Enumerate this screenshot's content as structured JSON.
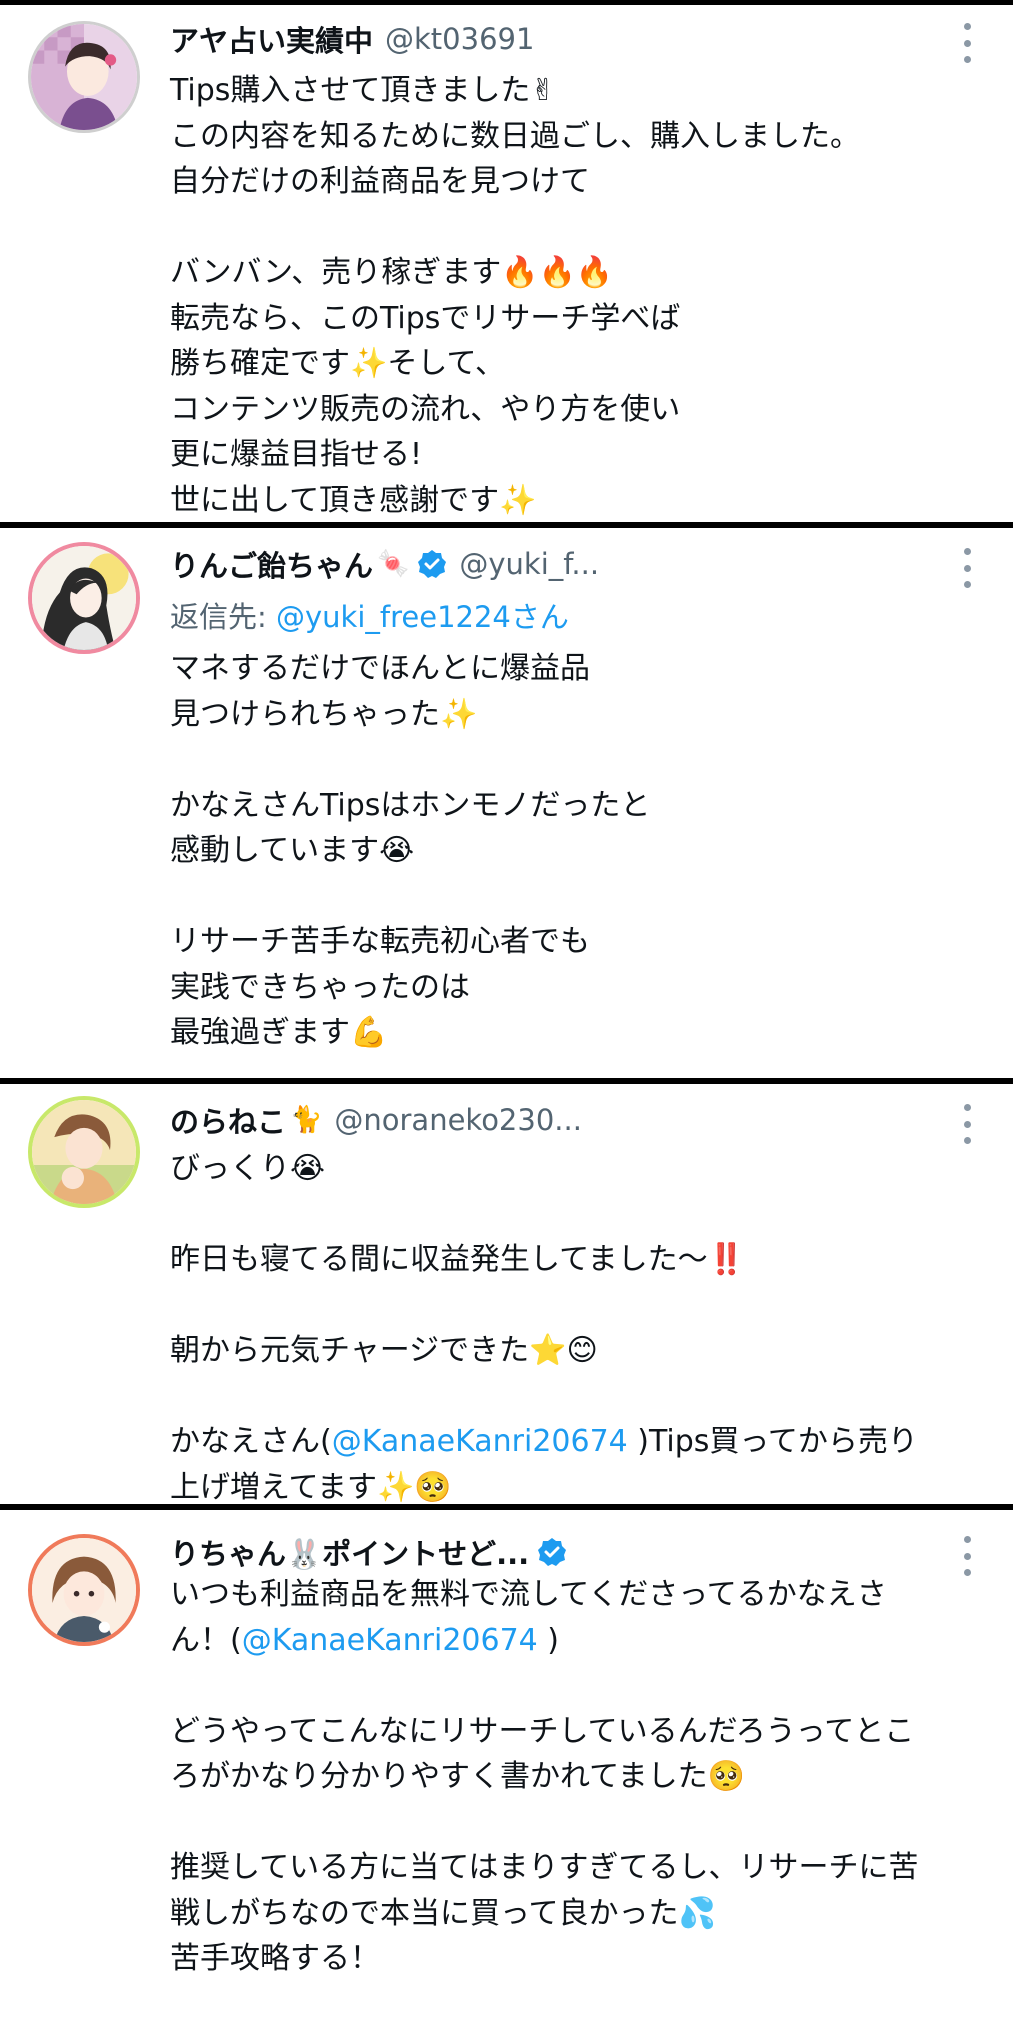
{
  "tweets": [
    {
      "name": "アヤ占い実績中",
      "handle": "@kt03691",
      "body": {
        "l1": "Tips購入させて頂きました✌",
        "l2": "この内容を知るために数日過ごし、購入しました。",
        "l3": "自分だけの利益商品を見つけて",
        "l4": "バンバン、売り稼ぎます🔥🔥🔥",
        "l5": "転売なら、このTipsでリサーチ学べば",
        "l6": "勝ち確定です✨そして、",
        "l7": "コンテンツ販売の流れ、やり方を使い",
        "l8": "更に爆益目指せる!",
        "l9": "世に出して頂き感謝です✨"
      }
    },
    {
      "name": "りんご飴ちゃん",
      "name_emoji": "🍬",
      "handle": "@yuki_f...",
      "reply_prefix": "返信先: ",
      "reply_to": "@yuki_free1224さん",
      "body": {
        "l1": "マネするだけでほんとに爆益品",
        "l2": "見つけられちゃった✨",
        "l3": "かなえさんTipsはホンモノだったと",
        "l4": "感動しています😭",
        "l5": "リサーチ苦手な転売初心者でも",
        "l6": "実践できちゃったのは",
        "l7": "最強過ぎます💪"
      }
    },
    {
      "name": "のらねこ",
      "name_emoji": "🐈",
      "handle": "@noraneko230...",
      "body": {
        "l1": "びっくり😭",
        "l2": "昨日も寝てる間に収益発生してました〜‼️",
        "l3": "朝から元気チャージできた⭐😊",
        "l4a": "かなえさん(",
        "l4m": "@KanaeKanri20674",
        "l4b": " )Tips買ってから売り",
        "l5": "上げ増えてます✨🥺"
      }
    },
    {
      "name": "りちゃん🐰ポイントせど...",
      "body": {
        "l1": "いつも利益商品を無料で流してくださってるかなえさ",
        "l2a": "ん！(",
        "l2m": "@KanaeKanri20674",
        "l2b": " )",
        "l3": "どうやってこんなにリサーチしているんだろうってとこ",
        "l4": "ろがかなり分かりやすく書かれてました🥺",
        "l5": "推奨している方に当てはまりすぎてるし、リサーチに苦",
        "l6": "戦しがちなので本当に買って良かった💦",
        "l7": "苦手攻略する！"
      }
    }
  ],
  "colors": {
    "name": "#0f1419",
    "handle": "#536471",
    "mention": "#1d9bf0",
    "verified": "#1d9bf0",
    "divider": "#000000"
  },
  "icons": [
    "more-vertical-icon",
    "verified-badge-icon"
  ]
}
